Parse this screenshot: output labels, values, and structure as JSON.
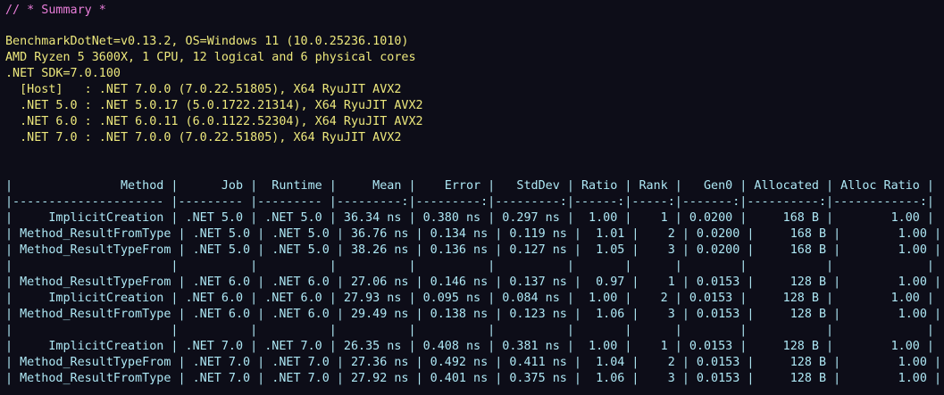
{
  "summary_comment": "// * Summary *",
  "environment": [
    "BenchmarkDotNet=v0.13.2, OS=Windows 11 (10.0.25236.1010)",
    "AMD Ryzen 5 3600X, 1 CPU, 12 logical and 6 physical cores",
    ".NET SDK=7.0.100",
    "  [Host]   : .NET 7.0.0 (7.0.22.51805), X64 RyuJIT AVX2",
    "  .NET 5.0 : .NET 5.0.17 (5.0.1722.21314), X64 RyuJIT AVX2",
    "  .NET 6.0 : .NET 6.0.11 (6.0.1122.52304), X64 RyuJIT AVX2",
    "  .NET 7.0 : .NET 7.0.0 (7.0.22.51805), X64 RyuJIT AVX2"
  ],
  "table_lines": [
    "|               Method |      Job |  Runtime |     Mean |    Error |   StdDev | Ratio | Rank |   Gen0 | Allocated | Alloc Ratio |",
    "|--------------------- |--------- |--------- |---------:|---------:|---------:|------:|-----:|-------:|----------:|------------:|",
    "|     ImplicitCreation | .NET 5.0 | .NET 5.0 | 36.34 ns | 0.380 ns | 0.297 ns |  1.00 |    1 | 0.0200 |     168 B |        1.00 |",
    "| Method_ResultFromType | .NET 5.0 | .NET 5.0 | 36.76 ns | 0.134 ns | 0.119 ns |  1.01 |    2 | 0.0200 |     168 B |        1.00 |",
    "| Method_ResultTypeFrom | .NET 5.0 | .NET 5.0 | 38.26 ns | 0.136 ns | 0.127 ns |  1.05 |    3 | 0.0200 |     168 B |        1.00 |",
    "|                      |          |          |          |          |          |       |      |        |           |             |",
    "| Method_ResultTypeFrom | .NET 6.0 | .NET 6.0 | 27.06 ns | 0.146 ns | 0.137 ns |  0.97 |    1 | 0.0153 |     128 B |        1.00 |",
    "|     ImplicitCreation | .NET 6.0 | .NET 6.0 | 27.93 ns | 0.095 ns | 0.084 ns |  1.00 |    2 | 0.0153 |     128 B |        1.00 |",
    "| Method_ResultFromType | .NET 6.0 | .NET 6.0 | 29.49 ns | 0.138 ns | 0.123 ns |  1.06 |    3 | 0.0153 |     128 B |        1.00 |",
    "|                      |          |          |          |          |          |       |      |        |           |             |",
    "|     ImplicitCreation | .NET 7.0 | .NET 7.0 | 26.35 ns | 0.408 ns | 0.381 ns |  1.00 |    1 | 0.0153 |     128 B |        1.00 |",
    "| Method_ResultTypeFrom | .NET 7.0 | .NET 7.0 | 27.36 ns | 0.492 ns | 0.411 ns |  1.04 |    2 | 0.0153 |     128 B |        1.00 |",
    "| Method_ResultFromType | .NET 7.0 | .NET 7.0 | 27.92 ns | 0.401 ns | 0.375 ns |  1.06 |    3 | 0.0153 |     128 B |        1.00 |"
  ],
  "colors": {
    "background": "#0d0d18",
    "comment": "#e87dd8",
    "info": "#ede87c",
    "table": "#aee8f5"
  }
}
